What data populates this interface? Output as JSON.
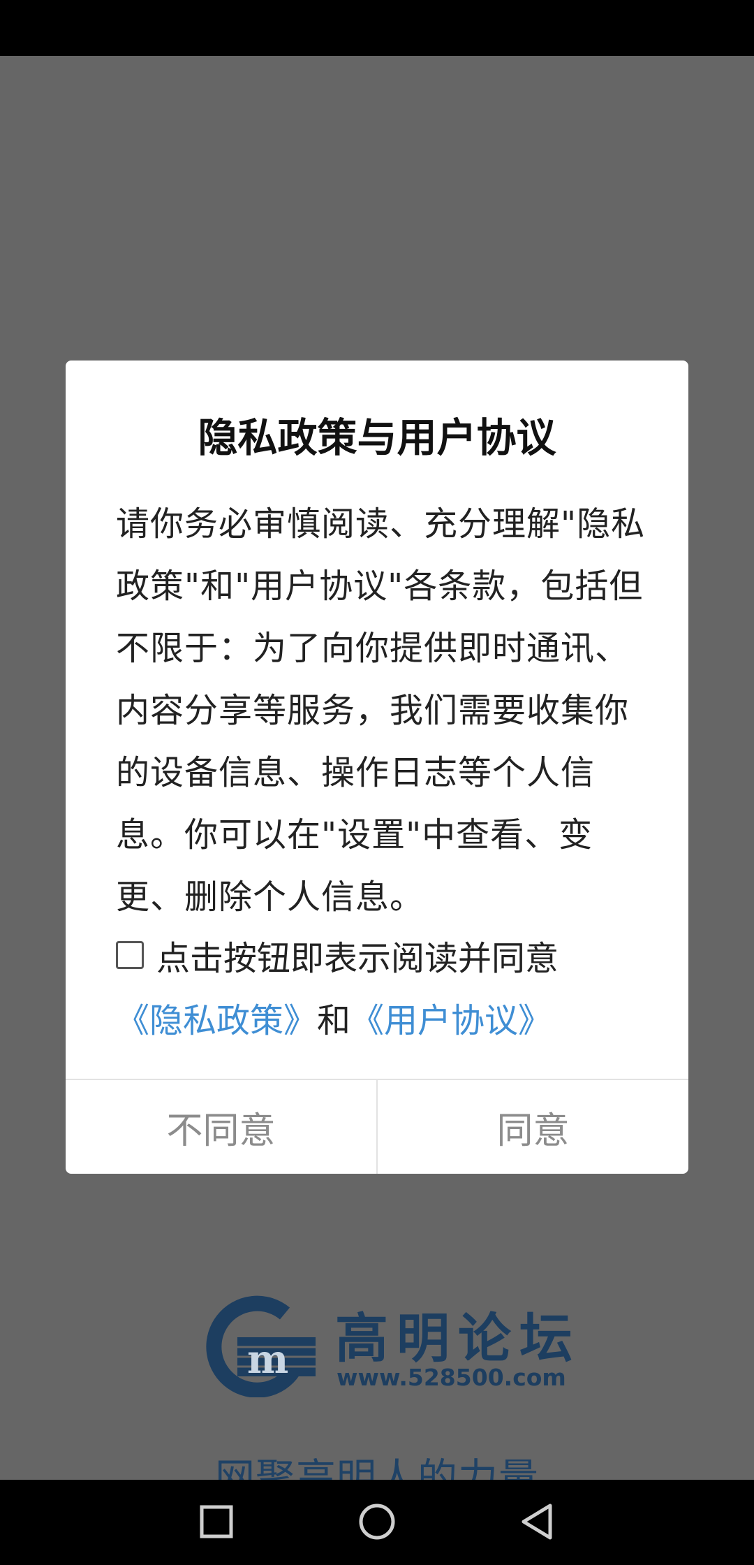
{
  "dialog": {
    "title": "隐私政策与用户协议",
    "body": "请你务必审慎阅读、充分理解\"隐私政策\"和\"用户协议\"各条款，包括但不限于：为了向你提供即时通讯、内容分享等服务，我们需要收集你的设备信息、操作日志等个人信息。你可以在\"设置\"中查看、变更、删除个人信息。",
    "consent_checked": false,
    "consent_text": "点击按钮即表示阅读并同意",
    "privacy_link": "《隐私政策》",
    "and_text": "和",
    "user_agreement_link": "《用户协议》",
    "disagree_label": "不同意",
    "agree_label": "同意"
  },
  "brand": {
    "name": "高明论坛",
    "url": "www.528500.com",
    "slogan": "网聚高明人的力量",
    "logo_icon": "gm-logo-icon"
  },
  "colors": {
    "link": "#3f8ed4",
    "brand": "#1d3e60",
    "overlay": "#666666",
    "button_text": "#8c8c8c"
  },
  "nav": {
    "recents_icon": "square-icon",
    "home_icon": "circle-icon",
    "back_icon": "triangle-back-icon"
  }
}
